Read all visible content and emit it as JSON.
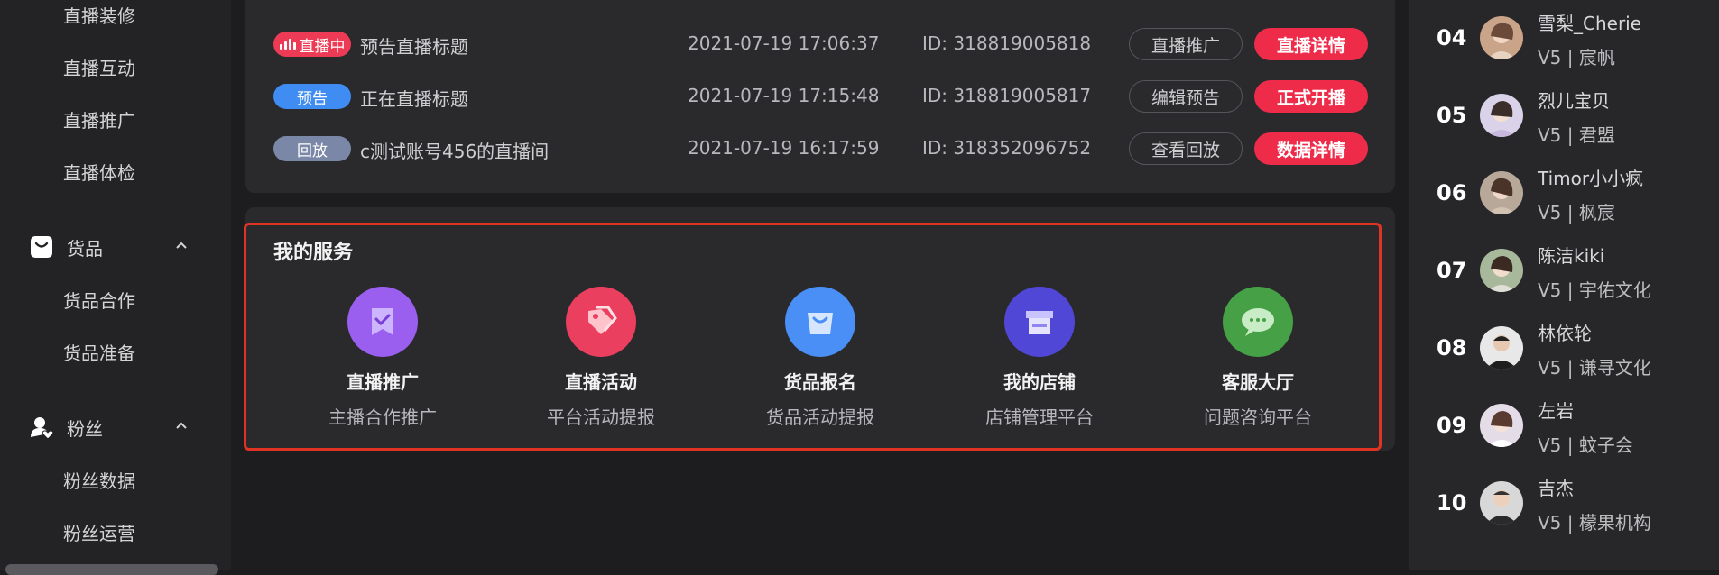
{
  "sidebar": {
    "sub_items_top": [
      "直播装修",
      "直播互动",
      "直播推广",
      "直播体检"
    ],
    "groups": [
      {
        "label": "货品",
        "icon": "bag-icon",
        "items": [
          "货品合作",
          "货品准备"
        ]
      },
      {
        "label": "粉丝",
        "icon": "fans-icon",
        "items": [
          "粉丝数据",
          "粉丝运营"
        ]
      }
    ]
  },
  "live_list": [
    {
      "status": "直播中",
      "status_type": "live",
      "title": "预告直播标题",
      "time": "2021-07-19 17:06:37",
      "id": "ID: 318819005818",
      "secondary": "直播推广",
      "primary": "直播详情"
    },
    {
      "status": "预告",
      "status_type": "preview",
      "title": "正在直播标题",
      "time": "2021-07-19 17:15:48",
      "id": "ID: 318819005817",
      "secondary": "编辑预告",
      "primary": "正式开播"
    },
    {
      "status": "回放",
      "status_type": "replay",
      "title": "c测试账号456的直播间",
      "time": "2021-07-19 16:17:59",
      "id": "ID: 318352096752",
      "secondary": "查看回放",
      "primary": "数据详情"
    }
  ],
  "services": {
    "title": "我的服务",
    "items": [
      {
        "name": "直播推广",
        "desc": "主播合作推广",
        "icon": "promotion-icon",
        "color": "#9b5ff0"
      },
      {
        "name": "直播活动",
        "desc": "平台活动提报",
        "icon": "tag-icon",
        "color": "#ea3f5f"
      },
      {
        "name": "货品报名",
        "desc": "货品活动提报",
        "icon": "shopping-bag-icon",
        "color": "#4a8ff5"
      },
      {
        "name": "我的店铺",
        "desc": "店铺管理平台",
        "icon": "store-icon",
        "color": "#5147d6"
      },
      {
        "name": "客服大厅",
        "desc": "问题咨询平台",
        "icon": "chat-icon",
        "color": "#45a046"
      }
    ]
  },
  "ranking": [
    {
      "rank": "04",
      "name": "雪梨_Cherie",
      "level": "V5",
      "org": "宸帆"
    },
    {
      "rank": "05",
      "name": "烈儿宝贝",
      "level": "V5",
      "org": "君盟"
    },
    {
      "rank": "06",
      "name": "Timor小小疯",
      "level": "V5",
      "org": "枫宸"
    },
    {
      "rank": "07",
      "name": "陈洁kiki",
      "level": "V5",
      "org": "宇佑文化"
    },
    {
      "rank": "08",
      "name": "林依轮",
      "level": "V5",
      "org": "谦寻文化"
    },
    {
      "rank": "09",
      "name": "左岩",
      "level": "V5",
      "org": "蚊子会"
    },
    {
      "rank": "10",
      "name": "吉杰",
      "level": "V5",
      "org": "檬果机构"
    }
  ],
  "rank_separator": "|"
}
